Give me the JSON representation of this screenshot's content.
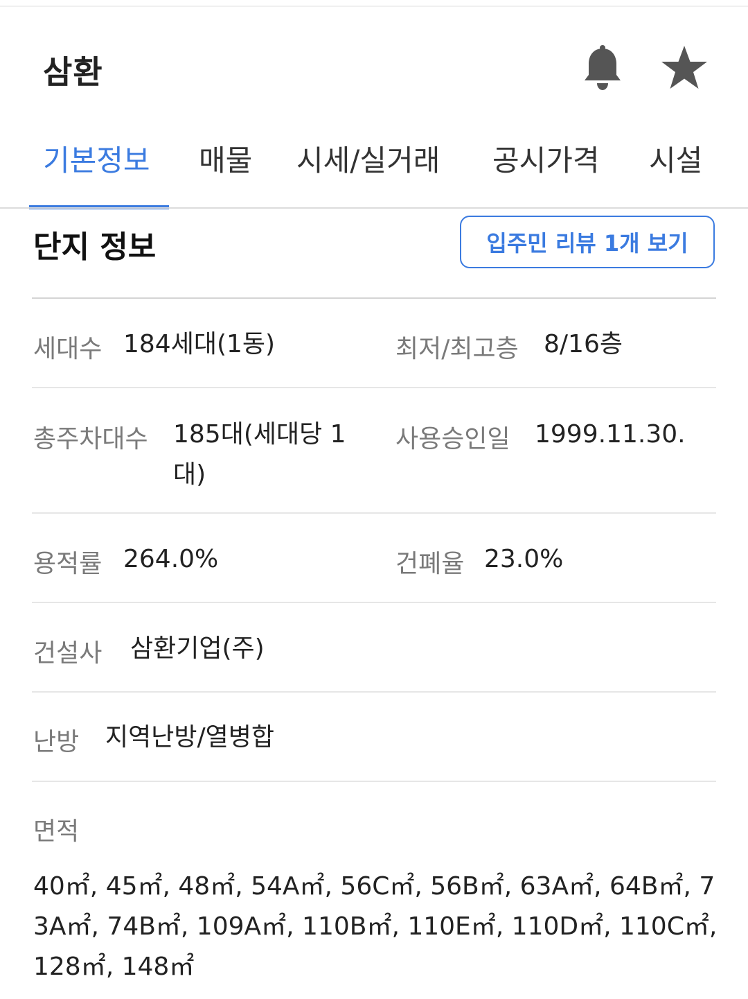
{
  "header": {
    "title": "삼환",
    "bell_icon": "bell-icon",
    "star_icon": "star-icon"
  },
  "tabs": [
    {
      "label": "기본정보",
      "active": true
    },
    {
      "label": "매물",
      "active": false
    },
    {
      "label": "시세/실거래",
      "active": false
    },
    {
      "label": "공시가격",
      "active": false
    },
    {
      "label": "시설",
      "active": false
    }
  ],
  "section": {
    "title": "단지 정보",
    "review_button": "입주민 리뷰 1개 보기"
  },
  "info": {
    "households": {
      "label": "세대수",
      "value": "184세대(1동)"
    },
    "floors": {
      "label": "최저/최고층",
      "value": "8/16층"
    },
    "parking": {
      "label": "총주차대수",
      "value": "185대(세대당 1대)"
    },
    "approval": {
      "label": "사용승인일",
      "value": "1999.11.30."
    },
    "far": {
      "label": "용적률",
      "value": "264.0%"
    },
    "bcr": {
      "label": "건폐율",
      "value": "23.0%"
    },
    "builder": {
      "label": "건설사",
      "value": "삼환기업(주)"
    },
    "heating": {
      "label": "난방",
      "value": "지역난방/열병합"
    },
    "area": {
      "label": "면적",
      "value": "40㎡, 45㎡, 48㎡, 54A㎡, 56C㎡, 56B㎡, 63A㎡, 64B㎡, 73A㎡, 74B㎡, 109A㎡, 110B㎡, 110E㎡, 110D㎡, 110C㎡, 128㎡, 148㎡"
    }
  },
  "colors": {
    "accent": "#3b7be0",
    "label": "#7a7a7a",
    "text": "#222222",
    "icon": "#555555"
  }
}
